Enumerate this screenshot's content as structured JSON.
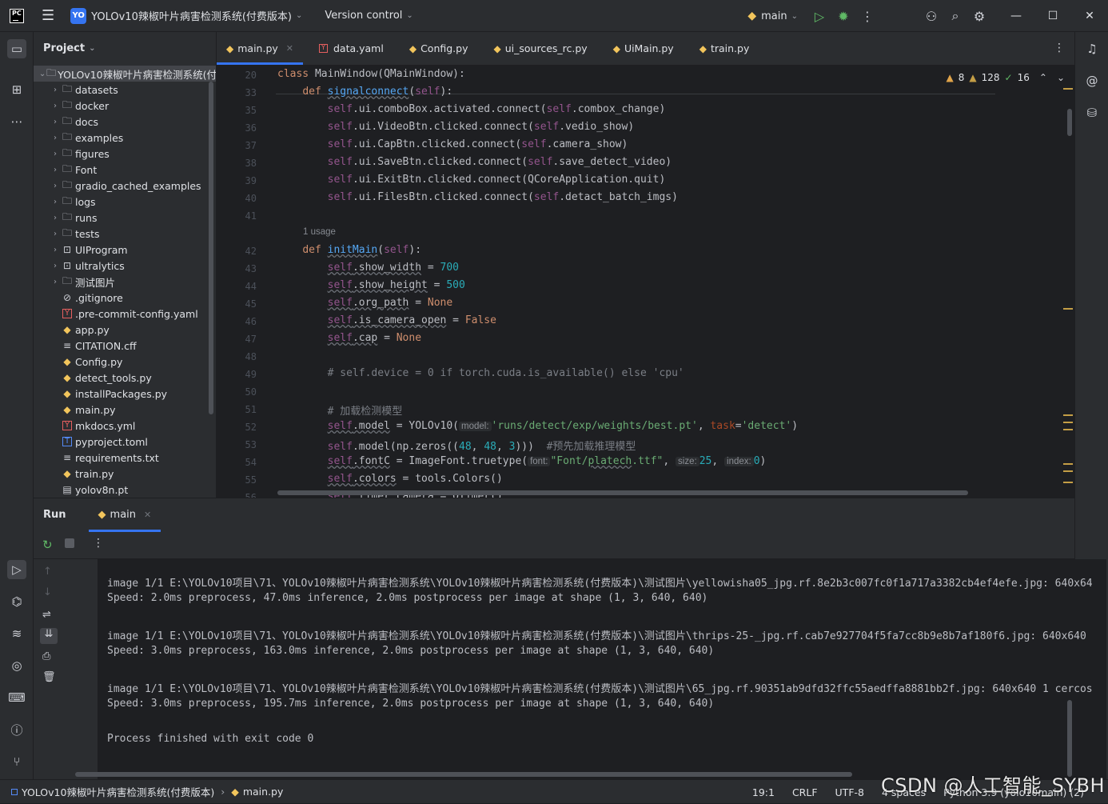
{
  "titlebar": {
    "logo": "PC",
    "project_badge": "YO",
    "project_name": "YOLOv10辣椒叶片病害检测系统(付费版本)",
    "vcs": "Version control",
    "run_config": "main"
  },
  "project_panel": {
    "title": "Project",
    "root": "YOLOv10辣椒叶片病害检测系统(付",
    "items": [
      {
        "label": "datasets",
        "type": "folder"
      },
      {
        "label": "docker",
        "type": "folder"
      },
      {
        "label": "docs",
        "type": "folder"
      },
      {
        "label": "examples",
        "type": "folder"
      },
      {
        "label": "figures",
        "type": "folder"
      },
      {
        "label": "Font",
        "type": "folder"
      },
      {
        "label": "gradio_cached_examples",
        "type": "folder"
      },
      {
        "label": "logs",
        "type": "folder"
      },
      {
        "label": "runs",
        "type": "folder"
      },
      {
        "label": "tests",
        "type": "folder"
      },
      {
        "label": "UIProgram",
        "type": "package"
      },
      {
        "label": "ultralytics",
        "type": "package"
      },
      {
        "label": "测试图片",
        "type": "folder"
      },
      {
        "label": ".gitignore",
        "type": "ignore"
      },
      {
        "label": ".pre-commit-config.yaml",
        "type": "yaml"
      },
      {
        "label": "app.py",
        "type": "py"
      },
      {
        "label": "CITATION.cff",
        "type": "text"
      },
      {
        "label": "Config.py",
        "type": "py"
      },
      {
        "label": "detect_tools.py",
        "type": "py"
      },
      {
        "label": "installPackages.py",
        "type": "py"
      },
      {
        "label": "main.py",
        "type": "py"
      },
      {
        "label": "mkdocs.yml",
        "type": "yaml"
      },
      {
        "label": "pyproject.toml",
        "type": "toml"
      },
      {
        "label": "requirements.txt",
        "type": "text"
      },
      {
        "label": "train.py",
        "type": "py"
      },
      {
        "label": "yolov8n.pt",
        "type": "file"
      }
    ]
  },
  "tabs": [
    {
      "label": "main.py",
      "type": "py",
      "active": true
    },
    {
      "label": "data.yaml",
      "type": "yaml"
    },
    {
      "label": "Config.py",
      "type": "py"
    },
    {
      "label": "ui_sources_rc.py",
      "type": "py"
    },
    {
      "label": "UiMain.py",
      "type": "py"
    },
    {
      "label": "train.py",
      "type": "py"
    }
  ],
  "inspections": {
    "warnings": "8",
    "weak_warnings": "128",
    "typos": "16"
  },
  "editor": {
    "line_numbers": [
      "20",
      "33",
      "35",
      "36",
      "37",
      "38",
      "39",
      "40",
      "41",
      "",
      "42",
      "43",
      "44",
      "45",
      "46",
      "47",
      "48",
      "49",
      "50",
      "51",
      "52",
      "53",
      "54",
      "55",
      "56"
    ],
    "usage_hint": "1 usage",
    "hints": {
      "model": "model:",
      "font": "font:",
      "size": "size:",
      "index": "index:"
    }
  },
  "run_panel": {
    "title": "Run",
    "tab": "main",
    "lines": [
      "image 1/1 E:\\YOLOv10项目\\71、YOLOv10辣椒叶片病害检测系统\\YOLOv10辣椒叶片病害检测系统(付费版本)\\测试图片\\yellowisha05_jpg.rf.8e2b3c007fc0f1a717a3382cb4ef4efe.jpg: 640x64",
      "Speed: 2.0ms preprocess, 47.0ms inference, 2.0ms postprocess per image at shape (1, 3, 640, 640)",
      "",
      "image 1/1 E:\\YOLOv10项目\\71、YOLOv10辣椒叶片病害检测系统\\YOLOv10辣椒叶片病害检测系统(付费版本)\\测试图片\\thrips-25-_jpg.rf.cab7e927704f5fa7cc8b9e8b7af180f6.jpg: 640x640",
      "Speed: 3.0ms preprocess, 163.0ms inference, 2.0ms postprocess per image at shape (1, 3, 640, 640)",
      "",
      "image 1/1 E:\\YOLOv10项目\\71、YOLOv10辣椒叶片病害检测系统\\YOLOv10辣椒叶片病害检测系统(付费版本)\\测试图片\\65_jpg.rf.90351ab9dfd32ffc55aedffa8881bb2f.jpg: 640x640 1 cercos",
      "Speed: 3.0ms preprocess, 195.7ms inference, 2.0ms postprocess per image at shape (1, 3, 640, 640)",
      "",
      "Process finished with exit code 0"
    ]
  },
  "statusbar": {
    "crumb_project": "YOLOv10辣椒叶片病害检测系统(付费版本)",
    "crumb_file": "main.py",
    "position": "19:1",
    "line_sep": "CRLF",
    "encoding": "UTF-8",
    "indent": "4 spaces",
    "interpreter": "Python 3.9 (yolo10main) (2)"
  },
  "watermark": "CSDN @人工智能_SYBH"
}
